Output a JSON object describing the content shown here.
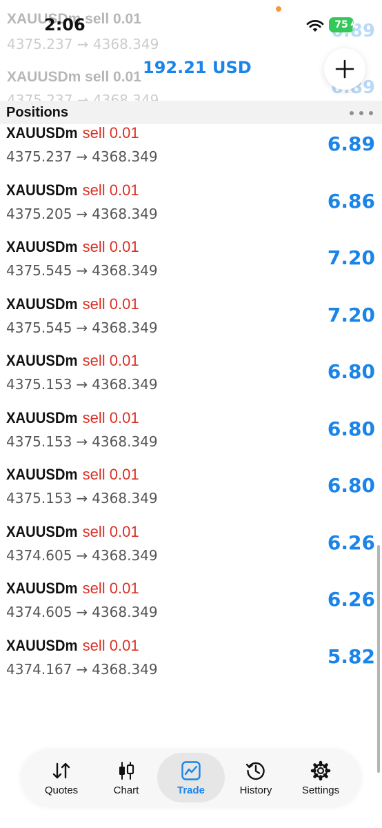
{
  "status_bar": {
    "time": "2:06",
    "battery": "75"
  },
  "header": {
    "balance": "192.21 USD",
    "add_icon": "plus-icon"
  },
  "ghost_rows": [
    {
      "symbol": "XAUUSDm sell 0.01",
      "price": "4375.237 → 4368.349",
      "profit": "6.89"
    },
    {
      "symbol": "XAUUSDm sell 0.01",
      "price": "4375.237 → 4368.349",
      "profit": "6.89"
    }
  ],
  "section": {
    "title": "Positions",
    "more_icon": "more-horizontal-icon"
  },
  "positions": [
    {
      "symbol": "XAUUSDm",
      "side": "sell",
      "volume": "0.01",
      "open_price": "4375.237",
      "current_price": "4368.349",
      "profit": "6.89"
    },
    {
      "symbol": "XAUUSDm",
      "side": "sell",
      "volume": "0.01",
      "open_price": "4375.205",
      "current_price": "4368.349",
      "profit": "6.86"
    },
    {
      "symbol": "XAUUSDm",
      "side": "sell",
      "volume": "0.01",
      "open_price": "4375.545",
      "current_price": "4368.349",
      "profit": "7.20"
    },
    {
      "symbol": "XAUUSDm",
      "side": "sell",
      "volume": "0.01",
      "open_price": "4375.545",
      "current_price": "4368.349",
      "profit": "7.20"
    },
    {
      "symbol": "XAUUSDm",
      "side": "sell",
      "volume": "0.01",
      "open_price": "4375.153",
      "current_price": "4368.349",
      "profit": "6.80"
    },
    {
      "symbol": "XAUUSDm",
      "side": "sell",
      "volume": "0.01",
      "open_price": "4375.153",
      "current_price": "4368.349",
      "profit": "6.80"
    },
    {
      "symbol": "XAUUSDm",
      "side": "sell",
      "volume": "0.01",
      "open_price": "4375.153",
      "current_price": "4368.349",
      "profit": "6.80"
    },
    {
      "symbol": "XAUUSDm",
      "side": "sell",
      "volume": "0.01",
      "open_price": "4374.605",
      "current_price": "4368.349",
      "profit": "6.26"
    },
    {
      "symbol": "XAUUSDm",
      "side": "sell",
      "volume": "0.01",
      "open_price": "4374.605",
      "current_price": "4368.349",
      "profit": "6.26"
    },
    {
      "symbol": "XAUUSDm",
      "side": "sell",
      "volume": "0.01",
      "open_price": "4374.167",
      "current_price": "4368.349",
      "profit": "5.82"
    }
  ],
  "arrow": "→",
  "tabs": [
    {
      "label": "Quotes",
      "icon": "quotes-icon",
      "active": false
    },
    {
      "label": "Chart",
      "icon": "chart-icon",
      "active": false
    },
    {
      "label": "Trade",
      "icon": "trade-icon",
      "active": true
    },
    {
      "label": "History",
      "icon": "history-icon",
      "active": false
    },
    {
      "label": "Settings",
      "icon": "settings-icon",
      "active": false
    }
  ],
  "colors": {
    "accent": "#1a84e8",
    "sell": "#d93025",
    "battery": "#34c759"
  }
}
